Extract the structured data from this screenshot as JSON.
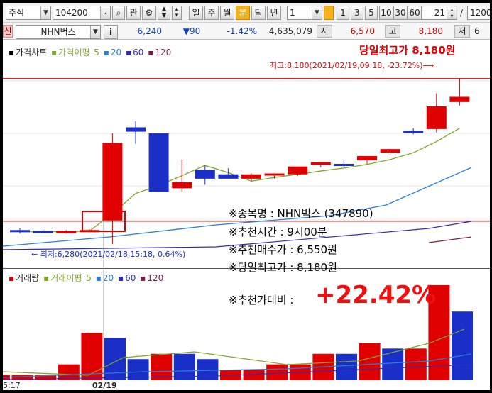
{
  "toolbar": {
    "market_type": "주식",
    "code": "104200",
    "btn_watch": "관",
    "period_buttons": [
      "일",
      "주",
      "월",
      "분",
      "틱",
      "년"
    ],
    "active_period": "분",
    "interval_value": "1",
    "minute_buttons": [
      "1",
      "3",
      "5",
      "10",
      "30",
      "60"
    ],
    "active_minute": "1",
    "count_value": "21",
    "slash": "/",
    "total_value": "1200"
  },
  "quote": {
    "indicator": "신",
    "name": "NHN벅스",
    "info_btn": "i",
    "price": "6,240",
    "change": "▼90",
    "change_pct": "-1.42%",
    "volume": "4,635,079",
    "open_label": "시",
    "open": "6,570",
    "high_label": "고",
    "high": "8,180",
    "low_label": "저",
    "low_trunc": "6"
  },
  "price_panel": {
    "legend_title": "가격차트",
    "legend_ma_label": "가격이평",
    "legend_ma_periods": [
      "5",
      "20",
      "60",
      "120"
    ],
    "high_title": "당일최고가 8,180원",
    "high_note": "최고:8,180(2021/02/19,09:18, -23.72%)⟶",
    "low_note": "← 최저:6,280(2021/02/18,15:18, 0.64%)"
  },
  "volume_panel": {
    "legend_title": "거래량",
    "legend_ma_label": "거래이평",
    "legend_ma_periods": [
      "5",
      "20",
      "60",
      "120"
    ]
  },
  "overlay": {
    "line1": "※종목명 : NHN벅스 (347890)",
    "line2": "※추천시간 : 9시00분",
    "line3": "※추천매수가 : 6,550원",
    "line4": "※당일최고가 : 8,180원",
    "line5_label": "※추천가대비 :",
    "line5_value": "+22.42%"
  },
  "xaxis": {
    "left_time": "5:17",
    "date_label": "02/19"
  },
  "colors": {
    "up": "#e00000",
    "down": "#1a2fc8",
    "ma5": "#7fa62b",
    "ma20": "#2a7fd4",
    "ma60": "#2d2db8",
    "ma120": "#7a1f4f",
    "overlay_value": "#ee1111"
  },
  "chart_data": {
    "type": "candlestick",
    "candles": [
      {
        "o": 6440,
        "h": 6460,
        "l": 6400,
        "c": 6420,
        "dir": "down"
      },
      {
        "o": 6430,
        "h": 6450,
        "l": 6410,
        "c": 6420,
        "dir": "down"
      },
      {
        "o": 6420,
        "h": 6440,
        "l": 6400,
        "c": 6430,
        "dir": "up"
      },
      {
        "o": 6430,
        "h": 6450,
        "l": 6420,
        "c": 6440,
        "dir": "up"
      },
      {
        "o": 6550,
        "h": 7550,
        "l": 6280,
        "c": 7440,
        "dir": "up"
      },
      {
        "o": 7620,
        "h": 7690,
        "l": 7430,
        "c": 7570,
        "dir": "down"
      },
      {
        "o": 7550,
        "h": 7550,
        "l": 6880,
        "c": 6880,
        "dir": "down"
      },
      {
        "o": 6920,
        "h": 7250,
        "l": 6880,
        "c": 6990,
        "dir": "up"
      },
      {
        "o": 7130,
        "h": 7180,
        "l": 6960,
        "c": 7030,
        "dir": "down"
      },
      {
        "o": 7080,
        "h": 7150,
        "l": 7030,
        "c": 7030,
        "dir": "down"
      },
      {
        "o": 7030,
        "h": 7090,
        "l": 7000,
        "c": 7080,
        "dir": "up"
      },
      {
        "o": 7080,
        "h": 7090,
        "l": 7030,
        "c": 7090,
        "dir": "up"
      },
      {
        "o": 7080,
        "h": 7110,
        "l": 7060,
        "c": 7170,
        "dir": "up"
      },
      {
        "o": 7190,
        "h": 7220,
        "l": 7160,
        "c": 7220,
        "dir": "up"
      },
      {
        "o": 7200,
        "h": 7240,
        "l": 7160,
        "c": 7200,
        "dir": "down"
      },
      {
        "o": 7240,
        "h": 7290,
        "l": 7200,
        "c": 7290,
        "dir": "up"
      },
      {
        "o": 7330,
        "h": 7370,
        "l": 7300,
        "c": 7370,
        "dir": "up"
      },
      {
        "o": 7580,
        "h": 7610,
        "l": 7540,
        "c": 7560,
        "dir": "down"
      },
      {
        "o": 7600,
        "h": 8010,
        "l": 7560,
        "c": 7860,
        "dir": "up"
      },
      {
        "o": 7910,
        "h": 8180,
        "l": 7870,
        "c": 7970,
        "dir": "up"
      }
    ],
    "volumes": [
      1,
      1,
      1,
      3,
      9,
      8,
      4,
      5,
      5,
      4,
      2,
      2,
      3,
      3,
      5,
      5,
      7,
      6,
      6,
      18,
      13
    ],
    "volume_dirs": [
      "up",
      "up",
      "up",
      "up",
      "up",
      "down",
      "down",
      "up",
      "down",
      "down",
      "up",
      "up",
      "up",
      "up",
      "up",
      "down",
      "up",
      "down",
      "up",
      "up",
      "down"
    ],
    "price_ylim": [
      6100,
      8300
    ]
  }
}
